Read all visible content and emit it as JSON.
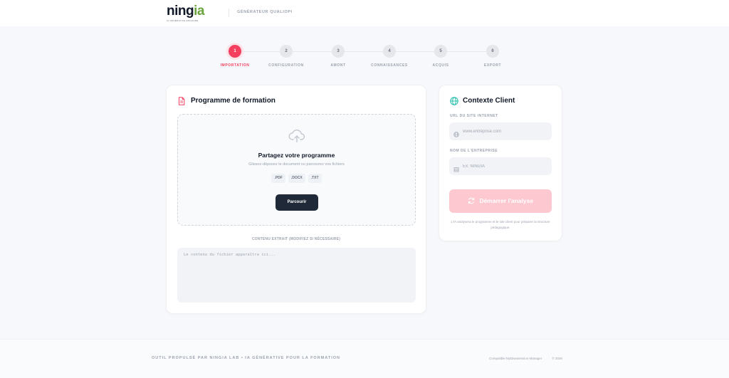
{
  "header": {
    "logo_prefix": "ning",
    "logo_accent": "ia",
    "logo_tagline": "IA GÉNÉRATIVE ENGAGÉE",
    "subtitle": "GÉNÉRATEUR QUALIOPI"
  },
  "stepper": {
    "steps": [
      {
        "number": "1",
        "label": "IMPORTATION",
        "active": true
      },
      {
        "number": "2",
        "label": "CONFIGURATION",
        "active": false
      },
      {
        "number": "3",
        "label": "AMONT",
        "active": false
      },
      {
        "number": "4",
        "label": "CONNAISSANCES",
        "active": false
      },
      {
        "number": "5",
        "label": "ACQUIS",
        "active": false
      },
      {
        "number": "6",
        "label": "EXPORT",
        "active": false
      }
    ]
  },
  "program": {
    "title": "Programme de formation",
    "icon": "document-icon",
    "dropzone": {
      "icon": "cloud-upload-icon",
      "title": "Partagez votre programme",
      "subtitle": "Glissez-déposez le document ou parcourez vos fichiers",
      "types": [
        ".PDF",
        ".DOCX",
        ".TXT"
      ],
      "button_label": "Parcourir"
    },
    "extract_label": "CONTENU EXTRAIT (MODIFIEZ SI NÉCESSAIRE)",
    "extract_placeholder": "Le contenu du fichier apparaîtra ici...",
    "extract_value": ""
  },
  "client": {
    "title": "Contexte Client",
    "icon": "globe-icon",
    "url_label": "URL DU SITE INTERNET",
    "url_placeholder": "www.entreprise.com",
    "url_value": "",
    "company_label": "NOM DE L'ENTREPRISE",
    "company_placeholder": "Ex: NINGIA",
    "company_value": "",
    "analyze_label": "Démarrer l'analyse",
    "note": "L'IA analysera le programme et le site client pour préparer la structure pédagogique."
  },
  "footer": {
    "left": "OUTIL PROPULSÉ PAR NINGIA LAB • IA GÉNÉRATIVE POUR LA FORMATION",
    "compat": "Compatible MyDiwosession Manager",
    "copyright": "© 2026"
  },
  "colors": {
    "accent": "#f43f5e",
    "accent_light": "#fec8d0",
    "brand_green": "#6aa33c",
    "dark_button": "#1f2937",
    "globe_teal": "#14b8a6"
  }
}
